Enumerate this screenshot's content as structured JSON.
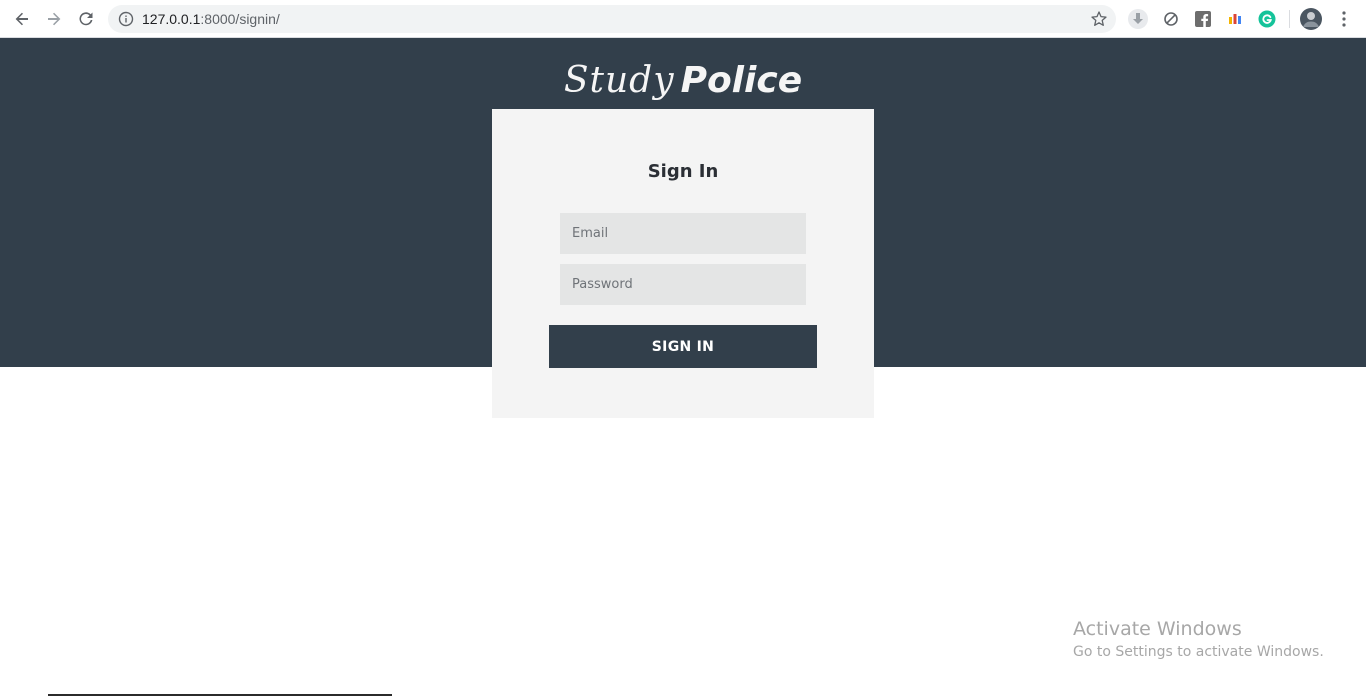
{
  "browser": {
    "url_host": "127.0.0.1",
    "url_path": ":8000/signin/",
    "icons": [
      "back-icon",
      "forward-icon",
      "reload-icon",
      "info-icon",
      "star-icon",
      "download-icon",
      "block-icon",
      "facebook-icon",
      "chart-icon",
      "grammarly-icon",
      "avatar",
      "menu-icon"
    ]
  },
  "brand": {
    "part1": "Study",
    "part2": "Police"
  },
  "signin": {
    "title": "Sign In",
    "email_placeholder": "Email",
    "password_placeholder": "Password",
    "button_label": "SIGN IN"
  },
  "watermark": {
    "line1": "Activate Windows",
    "line2": "Go to Settings to activate Windows."
  },
  "colors": {
    "hero_bg": "#323f4b",
    "card_bg": "#f4f4f4",
    "field_bg": "#e4e5e5",
    "button_bg": "#323f4b"
  }
}
